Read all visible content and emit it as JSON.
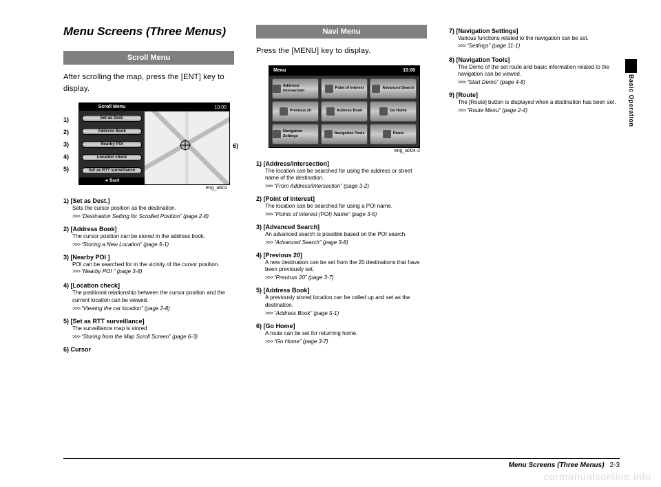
{
  "page": {
    "title": "Menu Screens (Three Menus)",
    "side_tab": "Basic Operation",
    "footer_title": "Menu Screens (Three Menus)",
    "footer_page": "2-3",
    "watermark": "carmanualsonline.info"
  },
  "col1": {
    "heading": "Scroll Menu",
    "intro": "After scrolling the map, press the [ENT] key to display.",
    "fig_caption": "eng_a601",
    "scroll_menu": {
      "title": "Scroll Menu",
      "clock": "10:00",
      "buttons": [
        "Set as Dest.",
        "Address Book",
        "Nearby POI",
        "Location check",
        "Set as RTT surveillance"
      ],
      "back": "◄ Back"
    },
    "callouts": {
      "c1": "1)",
      "c2": "2)",
      "c3": "3)",
      "c4": "4)",
      "c5": "5)",
      "c6": "6)"
    },
    "items": [
      {
        "num": "1)",
        "title": "[Set as Dest.]",
        "body": "Sets the cursor position as the destination.",
        "ref": "“Destination Setting for Scrolled Position” (page 2-8)"
      },
      {
        "num": "2)",
        "title": "[Address Book]",
        "body": "The cursor position can be stored in the address book.",
        "ref": "“Storing a New Location” (page 5-1)"
      },
      {
        "num": "3)",
        "title": "[Nearby POI ]",
        "body": "POI can be searched for in the vicinity of the cursor position.",
        "ref": "“Nearby POI ” (page 3-8)",
        "inline_ref": true
      },
      {
        "num": "4)",
        "title": "[Location check]",
        "body": "The positional relationship between the cursor position and the current location can be viewed.",
        "ref": "“Viewing the car location” (page 2-8)"
      },
      {
        "num": "5)",
        "title": "[Set as RTT surveillance]",
        "body": "The surveillance map is stored",
        "ref": "“Storing from the Map Scroll Screen” (page 6-3)"
      },
      {
        "num": "6)",
        "title": "Cursor",
        "body": "",
        "ref": ""
      }
    ]
  },
  "col2": {
    "heading": "Navi Menu",
    "intro": "Press the [MENU] key to display.",
    "fig_caption": "eng_a004-2",
    "navi_menu": {
      "title": "Menu",
      "clock": "10:00",
      "cells": [
        "Address/\nIntersection",
        "Point of\nInterest",
        "Advanced\nSearch",
        "Previous\n20",
        "Address\nBook",
        "Go Home",
        "Navigation\nSettings",
        "Navigation\nTools",
        "Route"
      ]
    },
    "items": [
      {
        "num": "1)",
        "title": "[Address/Intersection]",
        "body": "The location can be searched for using the address or street name of the destination.",
        "ref": "“From Address/Intersection” (page 3-2)"
      },
      {
        "num": "2)",
        "title": "[Point of Interest]",
        "body": "The location can be searched for using a POI name.",
        "ref": "“Points of Interest (POI) Name” (page 3-5)"
      },
      {
        "num": "3)",
        "title": "[Advanced Search]",
        "body": "An advanced search is possible based on the POI search.",
        "ref": "“Advanced Search” (page 3-8)"
      },
      {
        "num": "4)",
        "title": "[Previous 20]",
        "body": "A new destination can be set from the 20 destinations that have been previously set.",
        "ref": "“Previous 20” (page 3-7)"
      },
      {
        "num": "5)",
        "title": "[Address Book]",
        "body": "A previously stored location can be called up and set as the destination.",
        "ref": "“Address Book” (page 5-1)"
      },
      {
        "num": "6)",
        "title": "[Go Home]",
        "body": "A route can be set for returning home.",
        "ref": "“Go Home” (page 3-7)"
      }
    ]
  },
  "col3": {
    "items": [
      {
        "num": "7)",
        "title": "[Navigation Settings]",
        "body": "Various functions related to the navigation can be set.",
        "ref": "“Settings” (page 11-1)",
        "inline_ref": true
      },
      {
        "num": "8)",
        "title": "[Navigation Tools]",
        "body": "The Demo of the set route and basic information related to the navigation can be viewed.",
        "ref": "“Start Demo” (page 4-8)"
      },
      {
        "num": "9)",
        "title": "[Route]",
        "body": "The [Route] button is displayed when a destination has been set.",
        "ref": "“Route Menu” (page 2-4)"
      }
    ]
  }
}
